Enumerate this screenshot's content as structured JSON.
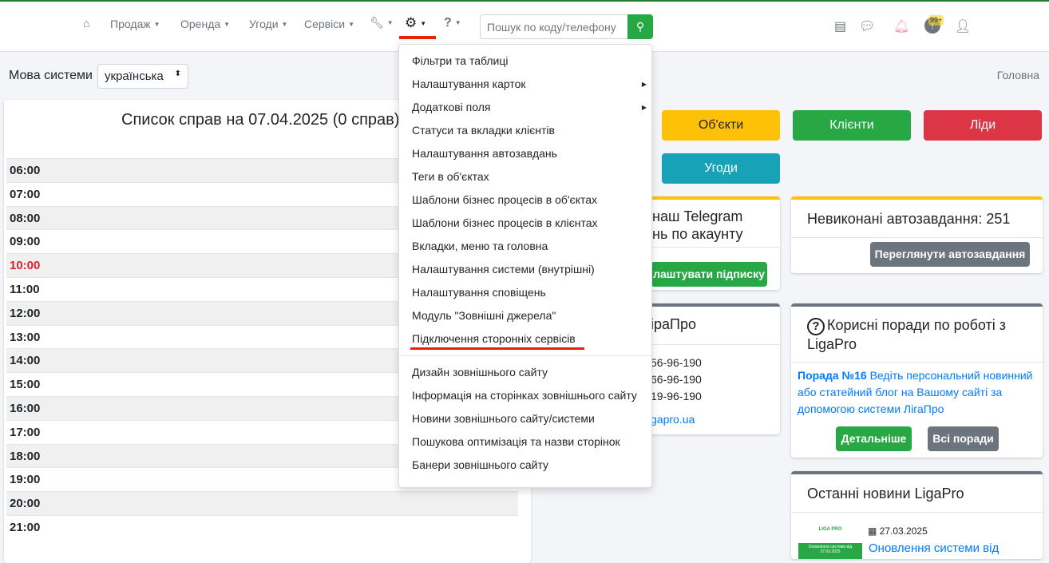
{
  "nav": {
    "items": [
      {
        "label": "Продаж"
      },
      {
        "label": "Оренда"
      },
      {
        "label": "Угоди"
      },
      {
        "label": "Сервіси"
      }
    ],
    "search_placeholder": "Пошук по коду/телефону",
    "notif_badge": "99+"
  },
  "lang": {
    "label": "Мова системи",
    "value": "українська"
  },
  "breadcrumb": "Головна",
  "tasks": {
    "title": "Список справ на 07.04.2025 (0 справ)",
    "times": [
      "06:00",
      "07:00",
      "08:00",
      "09:00",
      "10:00",
      "11:00",
      "12:00",
      "13:00",
      "14:00",
      "15:00",
      "16:00",
      "17:00",
      "18:00",
      "19:00",
      "20:00",
      "21:00"
    ],
    "current": "10:00"
  },
  "quick": {
    "objects": "Об'єкти",
    "clients": "Клієнти",
    "leads": "Ліди",
    "deals": "Угоди"
  },
  "telegram": {
    "title1": "наш Telegram",
    "title2": "нь по акаунту",
    "button": "лаштувати підписку"
  },
  "contacts": {
    "title": "іраПро",
    "phones": [
      "56-96-190",
      "66-96-190",
      "19-96-190"
    ],
    "site": "gapro.ua"
  },
  "autotasks": {
    "title": "Невиконані автозавдання: 251",
    "button": "Переглянути автозавдання"
  },
  "tips": {
    "title": "Корисні поради по роботі з LigaPro",
    "tip_label": "Порада №16",
    "tip_text": "Ведіть персональний новинний або статейний блог на Вашому сайті за допомогою системи ЛігаПро",
    "more": "Детальніше",
    "all": "Всі поради"
  },
  "news": {
    "title": "Останні новини LigaPro",
    "date": "27.03.2025",
    "headline": "Оновлення системи від",
    "thumb_logo": "LIGA PRO",
    "thumb_text": "Оновлення системи від 27.03.2025"
  },
  "menu": {
    "group1": [
      "Фільтри та таблиці",
      "Налаштування карток",
      "Додаткові поля",
      "Статуси та вкладки клієнтів",
      "Налаштування автозавдань",
      "Теги в об'єктах",
      "Шаблони бізнес процесів в об'єктах",
      "Шаблони бізнес процесів в клієнтах",
      "Вкладки, меню та головна",
      "Налаштування системи (внутрішні)",
      "Налаштування сповіщень",
      "Модуль \"Зовнішні джерела\"",
      "Підключення сторонніх сервісів"
    ],
    "group2": [
      "Дизайн зовнішнього сайту",
      "Інформація на сторінках зовнішнього сайту",
      "Новини зовнішнього сайту/системи",
      "Пошукова оптимізація та назви сторінок",
      "Банери зовнішнього сайту"
    ]
  }
}
